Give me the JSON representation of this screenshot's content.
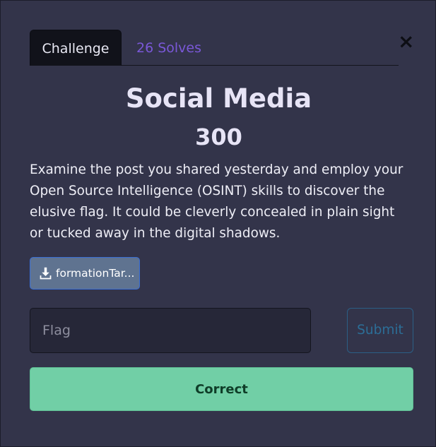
{
  "modal": {
    "close_label": "×"
  },
  "tabs": [
    {
      "label": "Challenge",
      "active": true
    },
    {
      "label": "26 Solves",
      "active": false
    }
  ],
  "challenge": {
    "title": "Social Media",
    "points": "300",
    "description": "Examine the post you shared yesterday and employ your Open Source Intelligence (OSINT) skills to discover the elusive flag. It could be cleverly concealed in plain sight or tucked away in the digital shadows.",
    "file": {
      "label": "formationTar...",
      "icon": "download-icon"
    }
  },
  "form": {
    "flag_placeholder": "Flag",
    "flag_value": "",
    "submit_label": "Submit"
  },
  "status": {
    "message": "Correct",
    "color": "#71cfa6"
  },
  "colors": {
    "background": "#33344a",
    "tab_active_bg": "#11121a",
    "tab_link": "#7a58d8",
    "file_button_bg": "#5f7390",
    "submit_outline": "#2b5f86",
    "success_bg": "#71cfa6"
  }
}
